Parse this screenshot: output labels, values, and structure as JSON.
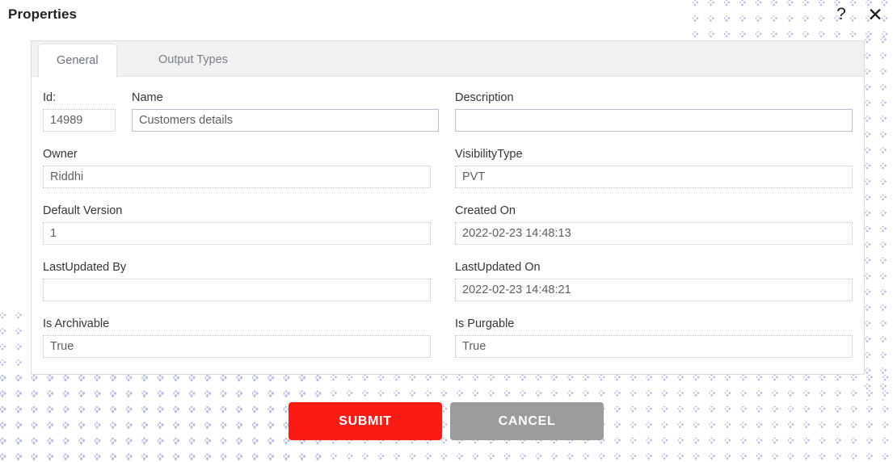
{
  "header": {
    "title": "Properties",
    "help_icon": "question-mark-icon",
    "help_glyph": "?",
    "close_icon": "close-icon",
    "close_glyph": "✕"
  },
  "tabs": [
    {
      "label": "General",
      "active": true
    },
    {
      "label": "Output Types",
      "active": false
    }
  ],
  "form": {
    "fields": [
      {
        "label": "Id:",
        "value": "14989",
        "readonly": true
      },
      {
        "label": "Name",
        "value": "Customers details",
        "readonly": false
      },
      {
        "label": "Description",
        "value": "",
        "readonly": false
      },
      {
        "label": "Owner",
        "value": "Riddhi",
        "readonly": true
      },
      {
        "label": "VisibilityType",
        "value": "PVT",
        "readonly": true
      },
      {
        "label": "Default Version",
        "value": "1",
        "readonly": true
      },
      {
        "label": "Created On",
        "value": "2022-02-23 14:48:13",
        "readonly": true
      },
      {
        "label": "LastUpdated By",
        "value": "",
        "readonly": true
      },
      {
        "label": "LastUpdated On",
        "value": "2022-02-23 14:48:21",
        "readonly": true
      },
      {
        "label": "Is Archivable",
        "value": "True",
        "readonly": true
      },
      {
        "label": "Is Purgable",
        "value": "True",
        "readonly": true
      }
    ]
  },
  "footer": {
    "submit_label": "SUBMIT",
    "cancel_label": "CANCEL"
  },
  "colors": {
    "submit_background": "#f91b14",
    "cancel_background": "#9c9c9c",
    "tab_bar_background": "#f1f1f1",
    "editable_border": "#b6c2d2",
    "readonly_border": "#c2c2c2",
    "pattern_dot": "#b9bfe0"
  }
}
